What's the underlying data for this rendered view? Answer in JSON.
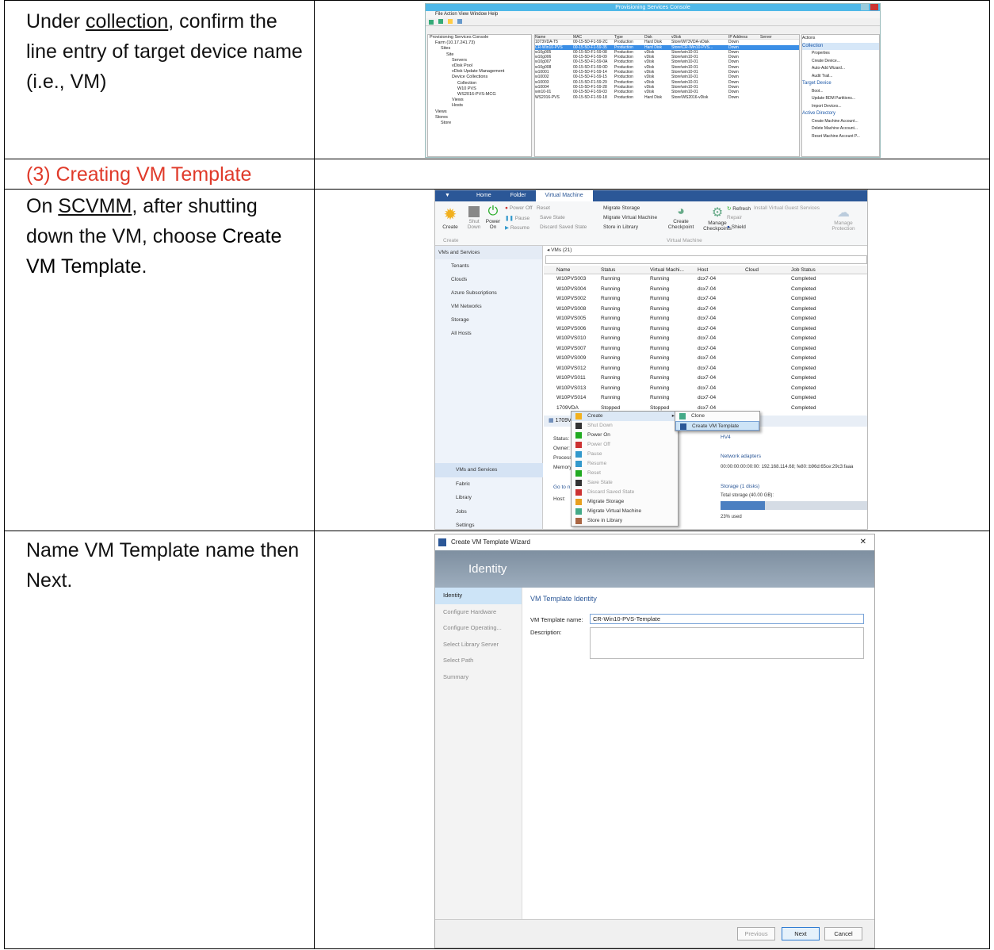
{
  "rows": [
    {
      "pre": "Under ",
      "link": "collection",
      "post": ", confirm the line entry of target device name (i.e., VM)"
    },
    {
      "heading": "(3) Creating VM Template"
    },
    {
      "pre": "On ",
      "link": "SCVMM",
      "mid": ", after shutting down the VM, choose ",
      "bold": "Create VM Template",
      "post": "."
    },
    {
      "text": "Name VM Template name then Next."
    }
  ],
  "pvs": {
    "title": "Provisioning Services Console",
    "menu": "File   Action   View   Window   Help",
    "tree": [
      "Provisioning Services Console",
      "Farm (10.17.241.73)",
      "Sites",
      "Site",
      "Servers",
      "vDisk Pool",
      "vDisk Update Management",
      "Device Collections",
      "Collection",
      "W10 PVS",
      "WS2016-PVS-MCG",
      "Views",
      "Hosts",
      "Views",
      "Stores",
      "Store"
    ],
    "headers": [
      "Name",
      "MAC",
      "Type",
      "Disk",
      "vDisk",
      "IP Address",
      "Server"
    ],
    "rows": [
      [
        "1073VDA-T5",
        "00-15-5D-F1-59-2C",
        "Production",
        "Hard Disk",
        "Store\\W73VDA-vDisk",
        "Down",
        ""
      ],
      [
        "CR-Win10-PVS",
        "00-15-5D-F1-59-35",
        "Production",
        "Hard Disk",
        "Store\\CR-Win10-PVS...",
        "Down",
        ""
      ],
      [
        "w10g005",
        "00-15-5D-F1-59-08",
        "Production",
        "vDisk",
        "Store\\win10-01",
        "Down",
        ""
      ],
      [
        "w10g006",
        "00-15-5D-F1-59-09",
        "Production",
        "vDisk",
        "Store\\win10-01",
        "Down",
        ""
      ],
      [
        "w10g007",
        "00-15-5D-F1-59-0A",
        "Production",
        "vDisk",
        "Store\\win10-01",
        "Down",
        ""
      ],
      [
        "w10g008",
        "00-15-5D-F1-59-0D",
        "Production",
        "vDisk",
        "Store\\win10-01",
        "Down",
        ""
      ],
      [
        "w10001",
        "00-15-5D-F1-59-14",
        "Production",
        "vDisk",
        "Store\\win10-01",
        "Down",
        ""
      ],
      [
        "w10002",
        "00-15-5D-F1-59-15",
        "Production",
        "vDisk",
        "Store\\win10-01",
        "Down",
        ""
      ],
      [
        "w10003",
        "00-15-5D-F1-59-29",
        "Production",
        "vDisk",
        "Store\\win10-01",
        "Down",
        ""
      ],
      [
        "w10004",
        "00-15-5D-F1-59-28",
        "Production",
        "vDisk",
        "Store\\win10-01",
        "Down",
        ""
      ],
      [
        "win10-01",
        "00-15-5D-F1-59-03",
        "Production",
        "vDisk",
        "Store\\win10-01",
        "Down",
        ""
      ],
      [
        "WS2016-PVS",
        "00-15-5D-F1-59-18",
        "Production",
        "Hard Disk",
        "Store\\WS2016-vDisk",
        "Down",
        ""
      ]
    ],
    "actions": {
      "header": "Actions",
      "groups": [
        {
          "name": "Collection",
          "items": [
            "Properties",
            "Create Device...",
            "Auto-Add Wizard...",
            "Audit Trail..."
          ]
        },
        {
          "name": "Target Device",
          "items": [
            "Boot...",
            "Update BDM Partitions...",
            "Import Devices..."
          ]
        },
        {
          "name": "Active Directory",
          "items": [
            "Create Machine Account...",
            "Delete Machine Account...",
            "Reset Machine Account P..."
          ]
        }
      ]
    }
  },
  "vmm": {
    "tabs": [
      "Home",
      "Folder",
      "Virtual Machine"
    ],
    "ribbon": {
      "create": "Create",
      "shut": "Shut Down",
      "power": "Power On",
      "poweroff": "Power Off",
      "reset": "Reset",
      "pause": "Pause",
      "resume": "Resume",
      "save": "Save State",
      "discard": "Discard Saved State",
      "migrate_storage": "Migrate Storage",
      "migrate_vm": "Migrate Virtual Machine",
      "store": "Store in Library",
      "checkpoint": "Create Checkpoint",
      "manage": "Manage Checkpoints",
      "refresh": "Refresh",
      "install": "Install Virtual Guest Services",
      "repair": "Repair",
      "shield": "Shield",
      "protection": "Manage Protection",
      "group_create": "Create",
      "group_vm": "Virtual Machine"
    },
    "nav_header": "VMs and Services",
    "nav": [
      "Tenants",
      "Clouds",
      "Azure Subscriptions",
      "VM Networks",
      "Storage",
      "All Hosts"
    ],
    "workspaces": [
      "VMs and Services",
      "Fabric",
      "Library",
      "Jobs",
      "Settings"
    ],
    "list_title": "VMs (21)",
    "headers": [
      "Name",
      "Status",
      "Virtual Machi...",
      "Host",
      "Cloud",
      "Job Status"
    ],
    "rows": [
      [
        "W10PVS003",
        "Running",
        "Running",
        "dcx7-04",
        "",
        "Completed"
      ],
      [
        "W10PVS004",
        "Running",
        "Running",
        "dcx7-04",
        "",
        "Completed"
      ],
      [
        "W10PVS002",
        "Running",
        "Running",
        "dcx7-04",
        "",
        "Completed"
      ],
      [
        "W10PVS008",
        "Running",
        "Running",
        "dcx7-04",
        "",
        "Completed"
      ],
      [
        "W10PVS005",
        "Running",
        "Running",
        "dcx7-04",
        "",
        "Completed"
      ],
      [
        "W10PVS006",
        "Running",
        "Running",
        "dcx7-04",
        "",
        "Completed"
      ],
      [
        "W10PVS010",
        "Running",
        "Running",
        "dcx7-04",
        "",
        "Completed"
      ],
      [
        "W10PVS007",
        "Running",
        "Running",
        "dcx7-04",
        "",
        "Completed"
      ],
      [
        "W10PVS009",
        "Running",
        "Running",
        "dcx7-04",
        "",
        "Completed"
      ],
      [
        "W10PVS012",
        "Running",
        "Running",
        "dcx7-04",
        "",
        "Completed"
      ],
      [
        "W10PVS011",
        "Running",
        "Running",
        "dcx7-04",
        "",
        "Completed"
      ],
      [
        "W10PVS013",
        "Running",
        "Running",
        "dcx7-04",
        "",
        "Completed"
      ],
      [
        "W10PVS014",
        "Running",
        "Running",
        "dcx7-04",
        "",
        "Completed"
      ],
      [
        "1709VDA",
        "Stopped",
        "Stopped",
        "dcx7-04",
        "",
        "Completed"
      ]
    ],
    "detail": {
      "name": "1709VDA",
      "status": "Status:",
      "owner": "Owner:",
      "processor": "Processo",
      "memory": "Memory",
      "goto": "Go to n",
      "host": "Host:",
      "hv": "HV4",
      "net_h": "Network adapters",
      "net_v": "00:00:00:00:00:00: 192.168.114.68; fe80::b96d:65ce:29c3:faaa",
      "stor_h": "Storage (1 disks)",
      "stor_v": "Total storage (40.00 GB):",
      "used": "23% used",
      "used_frac": 0.3
    },
    "ctx": [
      "Create",
      "Shut Down",
      "Power On",
      "Power Off",
      "Pause",
      "Resume",
      "Reset",
      "Save State",
      "Discard Saved State",
      "Migrate Storage",
      "Migrate Virtual Machine",
      "Store in Library"
    ],
    "sub": [
      "Clone",
      "Create VM Template"
    ]
  },
  "wizard": {
    "title": "Create VM Template Wizard",
    "band": "Identity",
    "steps": [
      "Identity",
      "Configure Hardware",
      "Configure Operating...",
      "Select Library Server",
      "Select Path",
      "Summary"
    ],
    "heading": "VM Template Identity",
    "name_label": "VM Template name:",
    "name_value": "CR-Win10-PVS-Template",
    "desc_label": "Description:",
    "prev": "Previous",
    "next": "Next",
    "cancel": "Cancel"
  }
}
